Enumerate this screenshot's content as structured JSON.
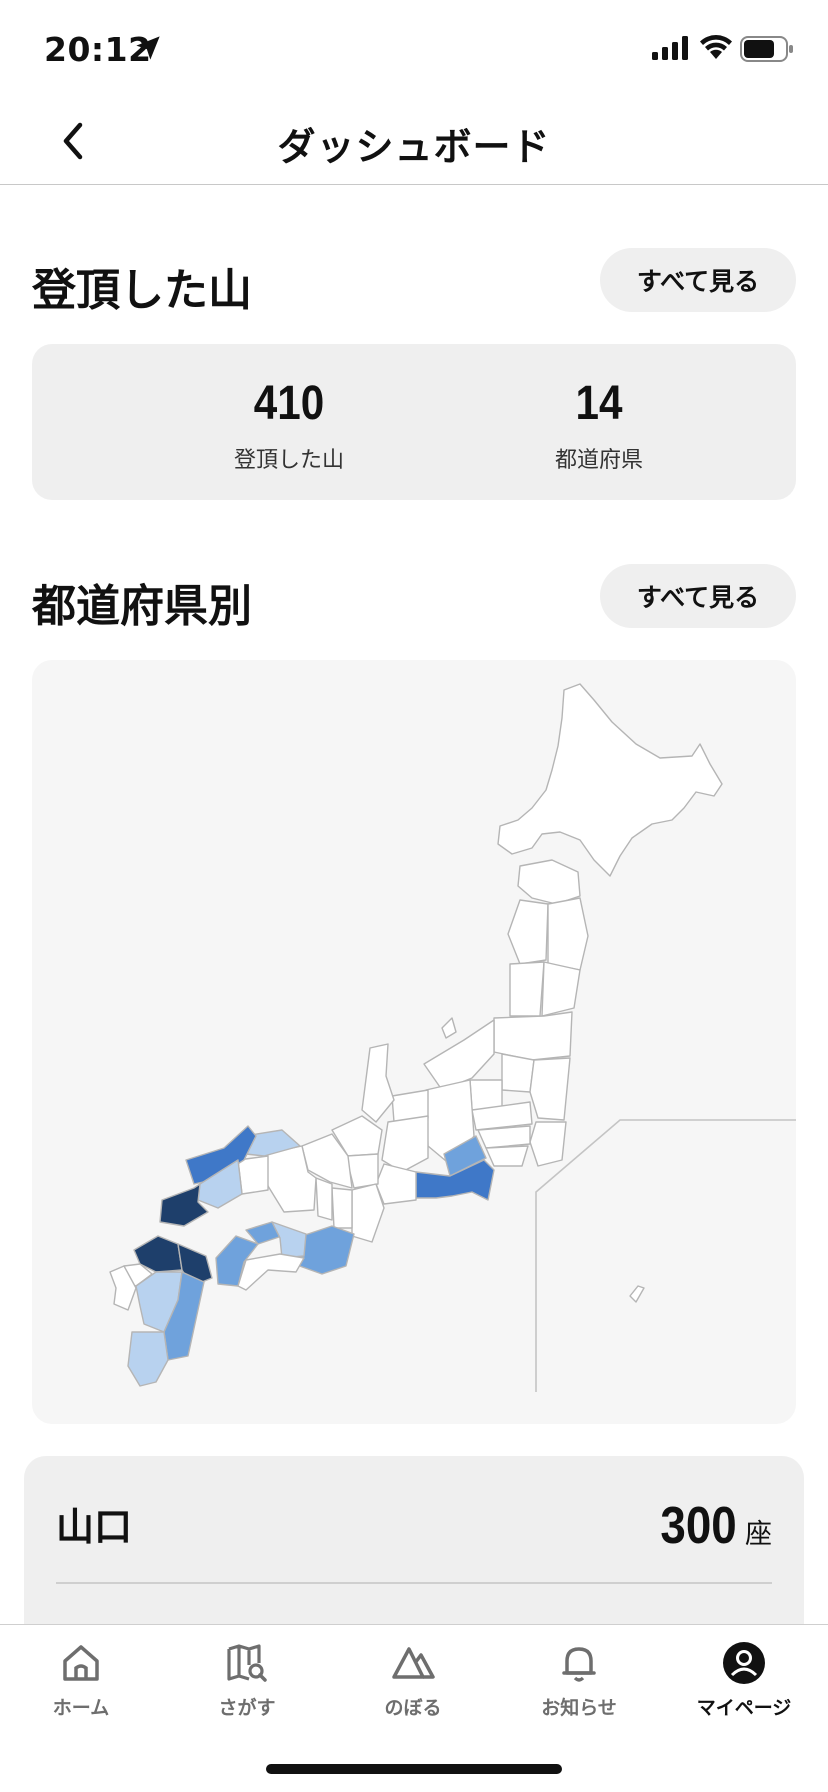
{
  "status_bar": {
    "time": "20:12"
  },
  "nav": {
    "title": "ダッシュボード"
  },
  "climbed": {
    "title": "登頂した山",
    "see_all_label": "すべて見る",
    "mountains_value": "410",
    "mountains_label": "登頂した山",
    "prefectures_value": "14",
    "prefectures_label": "都道府県"
  },
  "by_prefecture": {
    "title": "都道府県別",
    "see_all_label": "すべて見る",
    "colors": {
      "dark": "#1e3f6b",
      "strong": "#3f78c8",
      "medium": "#6fa2dc",
      "light": "#b8d2ef",
      "none": "#ffffff",
      "border": "#b5b5b5"
    }
  },
  "prefecture_list": [
    {
      "name": "山口",
      "count": "300",
      "unit": "座"
    }
  ],
  "tab_bar": {
    "tabs": [
      {
        "label": "ホーム",
        "icon": "home-icon"
      },
      {
        "label": "さがす",
        "icon": "map-search-icon"
      },
      {
        "label": "のぼる",
        "icon": "mountain-icon"
      },
      {
        "label": "お知らせ",
        "icon": "bell-icon"
      },
      {
        "label": "マイページ",
        "icon": "user-icon",
        "active": true
      }
    ]
  }
}
